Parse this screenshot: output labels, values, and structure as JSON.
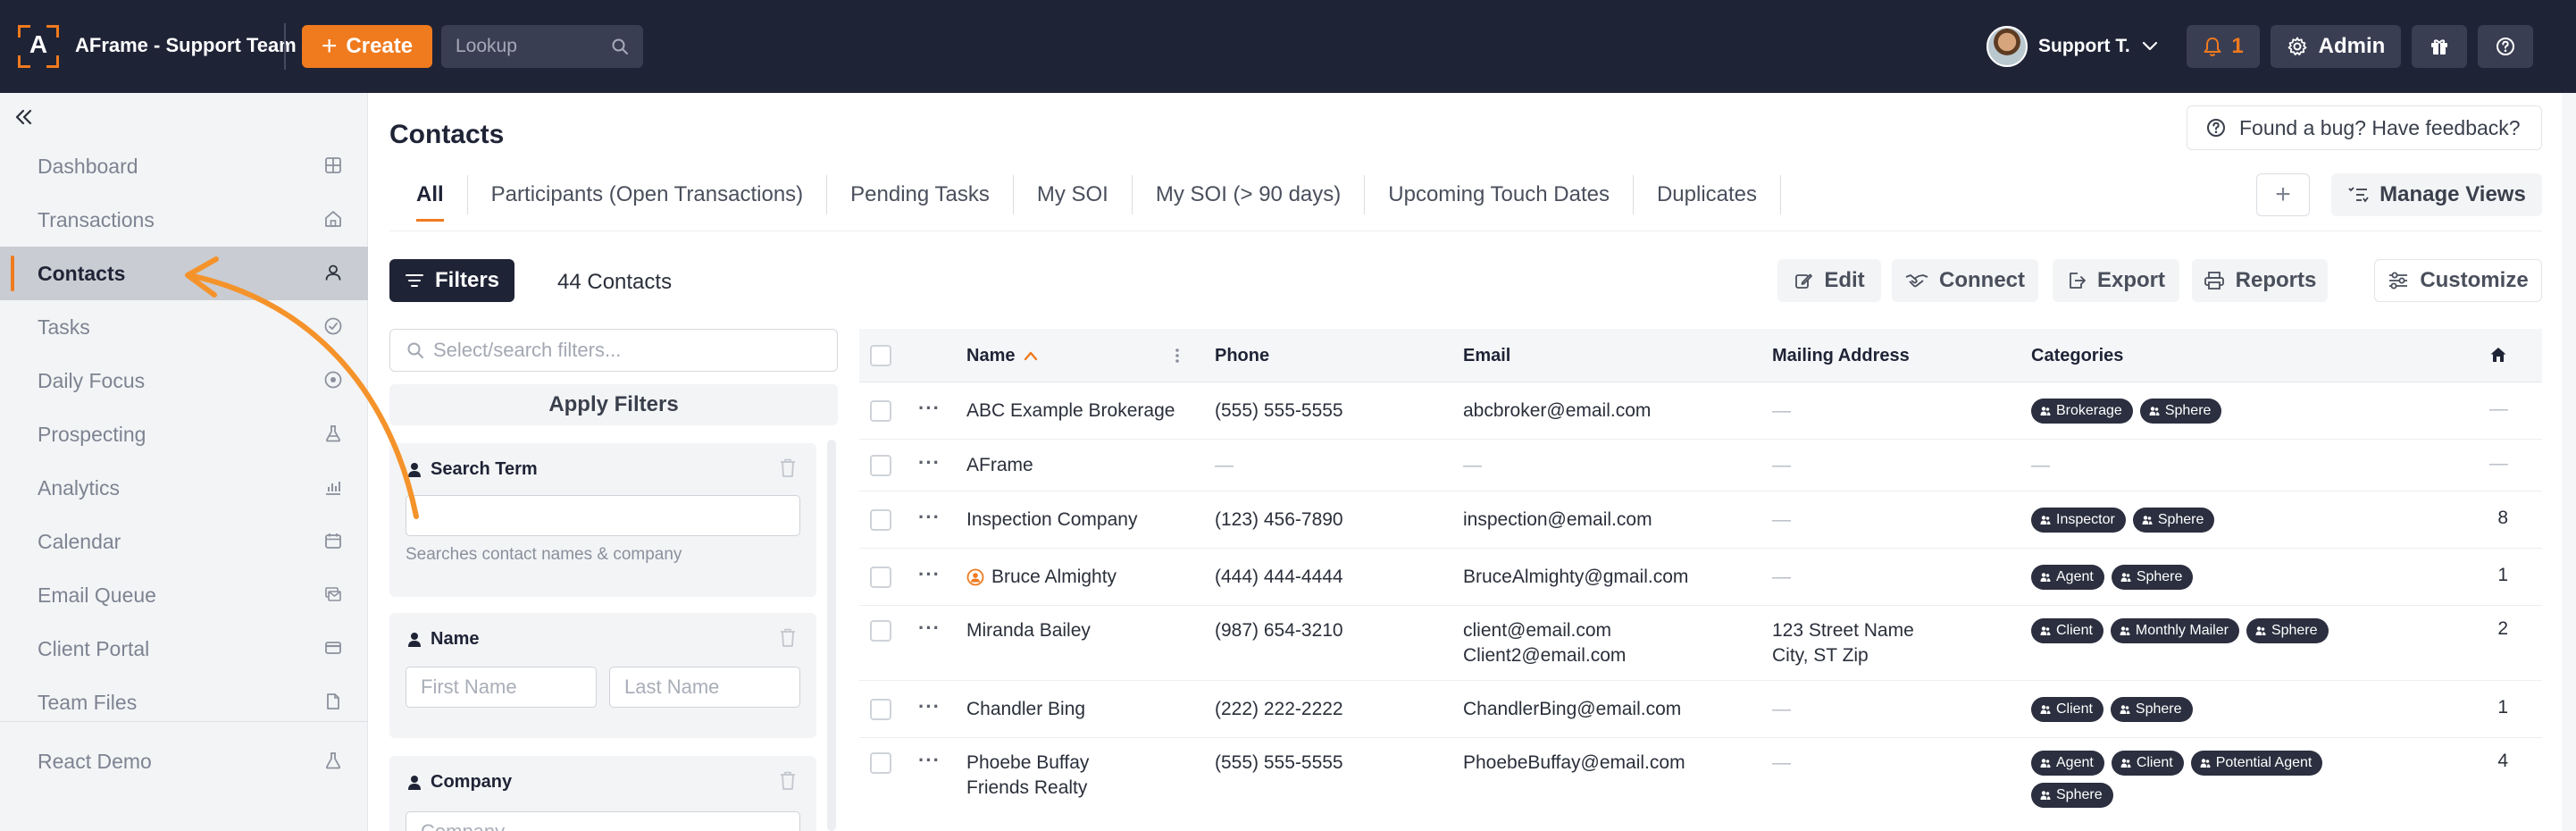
{
  "app": {
    "logo_letter": "A",
    "team_title": "AFrame - Support Team"
  },
  "topbar": {
    "create_label": "Create",
    "lookup_placeholder": "Lookup",
    "user_name": "Support T.",
    "notification_count": "1",
    "admin_label": "Admin"
  },
  "sidebar": {
    "items": [
      {
        "label": "Dashboard",
        "icon": "grid-icon"
      },
      {
        "label": "Transactions",
        "icon": "house-icon"
      },
      {
        "label": "Contacts",
        "icon": "person-icon",
        "active": true
      },
      {
        "label": "Tasks",
        "icon": "check-circle-icon"
      },
      {
        "label": "Daily Focus",
        "icon": "target-icon"
      },
      {
        "label": "Prospecting",
        "icon": "flask-icon"
      },
      {
        "label": "Analytics",
        "icon": "bar-chart-icon"
      },
      {
        "label": "Calendar",
        "icon": "calendar-icon"
      },
      {
        "label": "Email Queue",
        "icon": "mail-stack-icon"
      },
      {
        "label": "Client Portal",
        "icon": "card-icon"
      },
      {
        "label": "Team Files",
        "icon": "file-icon"
      }
    ],
    "bottom_items": [
      {
        "label": "React Demo",
        "icon": "beaker-icon"
      }
    ]
  },
  "page": {
    "title": "Contacts",
    "feedback_label": "Found a bug? Have feedback?",
    "tabs": [
      "All",
      "Participants (Open Transactions)",
      "Pending Tasks",
      "My SOI",
      "My SOI (> 90 days)",
      "Upcoming Touch Dates",
      "Duplicates"
    ],
    "active_tab": "All",
    "add_view_label": "+",
    "manage_views_label": "Manage Views"
  },
  "toolbar": {
    "filters_label": "Filters",
    "count_label": "44 Contacts",
    "edit_label": "Edit",
    "connect_label": "Connect",
    "export_label": "Export",
    "reports_label": "Reports",
    "customize_label": "Customize"
  },
  "filters": {
    "search_placeholder": "Select/search filters...",
    "apply_label": "Apply Filters",
    "search_term": {
      "title": "Search Term",
      "value": "",
      "hint": "Searches contact names & company"
    },
    "name": {
      "title": "Name",
      "first_placeholder": "First Name",
      "last_placeholder": "Last Name"
    },
    "company": {
      "title": "Company",
      "placeholder": "Company"
    }
  },
  "table": {
    "columns": {
      "name": "Name",
      "phone": "Phone",
      "email": "Email",
      "mailing_address": "Mailing Address",
      "categories": "Categories"
    },
    "sort": {
      "column": "Name",
      "direction": "ascending"
    },
    "rows": [
      {
        "name": "ABC Example Brokerage",
        "company": "",
        "phone": "(555) 555-5555",
        "emails": [
          "abcbroker@email.com"
        ],
        "address": [
          "—"
        ],
        "categories": [
          "Brokerage",
          "Sphere"
        ],
        "count": "—",
        "linked_user": false
      },
      {
        "name": "AFrame",
        "company": "",
        "phone": "—",
        "emails": [
          "—"
        ],
        "address": [
          "—"
        ],
        "categories": [],
        "categories_empty": "—",
        "count": "—",
        "linked_user": false
      },
      {
        "name": "Inspection Company",
        "company": "",
        "phone": "(123) 456-7890",
        "emails": [
          "inspection@email.com"
        ],
        "address": [
          "—"
        ],
        "categories": [
          "Inspector",
          "Sphere"
        ],
        "count": "8",
        "linked_user": false
      },
      {
        "name": "Bruce Almighty",
        "company": "",
        "phone": "(444) 444-4444",
        "emails": [
          "BruceAlmighty@gmail.com"
        ],
        "address": [
          "—"
        ],
        "categories": [
          "Agent",
          "Sphere"
        ],
        "count": "1",
        "linked_user": true
      },
      {
        "name": "Miranda Bailey",
        "company": "",
        "phone": "(987) 654-3210",
        "emails": [
          "client@email.com",
          "Client2@email.com"
        ],
        "address": [
          "123 Street Name",
          "City, ST Zip"
        ],
        "categories": [
          "Client",
          "Monthly Mailer",
          "Sphere"
        ],
        "count": "2",
        "linked_user": false
      },
      {
        "name": "Chandler Bing",
        "company": "",
        "phone": "(222) 222-2222",
        "emails": [
          "ChandlerBing@email.com"
        ],
        "address": [
          "—"
        ],
        "categories": [
          "Client",
          "Sphere"
        ],
        "count": "1",
        "linked_user": false
      },
      {
        "name": "Phoebe Buffay",
        "company": "Friends Realty",
        "phone": "(555) 555-5555",
        "emails": [
          "PhoebeBuffay@email.com"
        ],
        "address": [
          "—"
        ],
        "categories": [
          "Agent",
          "Client",
          "Potential Agent",
          "Sphere"
        ],
        "count": "4",
        "linked_user": false
      }
    ]
  },
  "colors": {
    "brand_orange": "#f07a1e",
    "topbar_bg": "#1f2336",
    "chip_bg": "#2b2f3f",
    "annotation_arrow": "#f5932b"
  }
}
